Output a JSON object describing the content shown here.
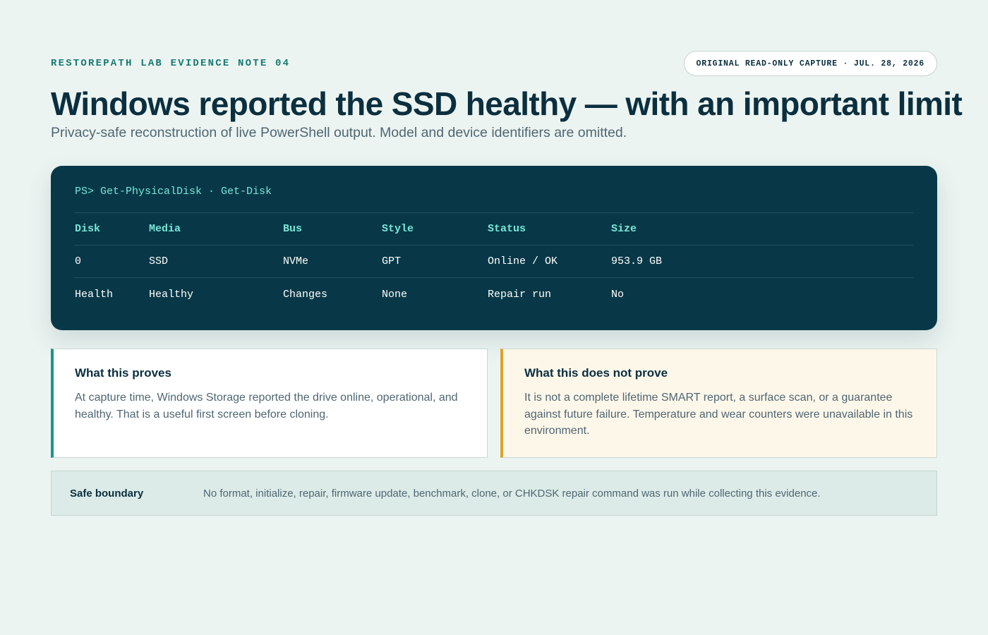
{
  "header": {
    "eyebrow": "RESTOREPATH LAB EVIDENCE NOTE 04",
    "pill": "ORIGINAL READ-ONLY CAPTURE · JUL. 28, 2026",
    "title": "Windows reported the SSD healthy — with an important limit",
    "subtitle": "Privacy-safe reconstruction of live PowerShell output. Model and device identifiers are omitted."
  },
  "terminal": {
    "command": "PS> Get-PhysicalDisk · Get-Disk",
    "headers": [
      "Disk",
      "Media",
      "Bus",
      "Style",
      "Status",
      "Size"
    ],
    "rows": [
      [
        "0",
        "SSD",
        "NVMe",
        "GPT",
        "Online / OK",
        "953.9 GB"
      ],
      [
        "Health",
        "Healthy",
        "Changes",
        "None",
        "Repair run",
        "No"
      ]
    ]
  },
  "proves": {
    "title": "What this proves",
    "body": "At capture time, Windows Storage reported the drive online, operational, and healthy. That is a useful first screen before cloning."
  },
  "not_proves": {
    "title": "What this does not prove",
    "body": "It is not a complete lifetime SMART report, a surface scan, or a guarantee against future failure. Temperature and wear counters were unavailable in this environment."
  },
  "boundary": {
    "label": "Safe boundary",
    "text": "No format, initialize, repair, firmware update, benchmark, clone, or CHKDSK repair command was run while collecting this evidence."
  },
  "colors": {
    "background": "#ecf4f1",
    "terminal_bg": "#083847",
    "accent_teal": "#17968c",
    "accent_amber": "#e0a12a",
    "terminal_highlight": "#78e6d8"
  }
}
